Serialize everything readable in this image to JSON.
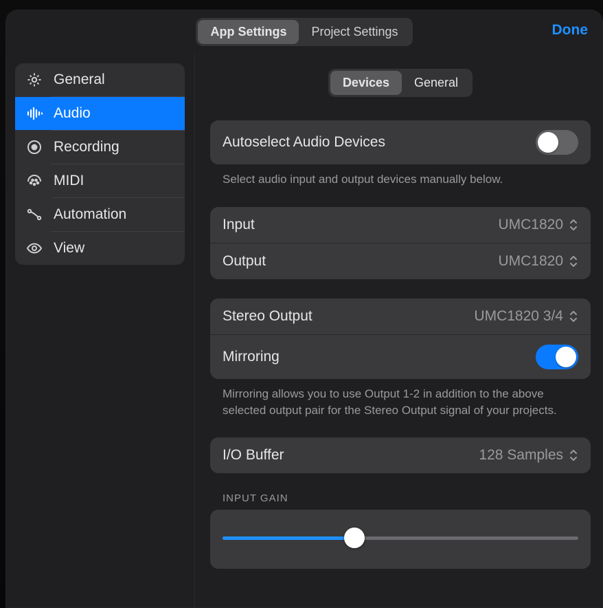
{
  "top": {
    "done": "Done",
    "seg": {
      "app": "App Settings",
      "project": "Project Settings"
    }
  },
  "sidebar": {
    "items": [
      {
        "label": "General"
      },
      {
        "label": "Audio"
      },
      {
        "label": "Recording"
      },
      {
        "label": "MIDI"
      },
      {
        "label": "Automation"
      },
      {
        "label": "View"
      }
    ]
  },
  "subseg": {
    "devices": "Devices",
    "general": "General"
  },
  "rows": {
    "autoselect": {
      "label": "Autoselect Audio Devices"
    },
    "autoselect_hint": "Select audio input and output devices manually below.",
    "input": {
      "label": "Input",
      "value": "UMC1820"
    },
    "output": {
      "label": "Output",
      "value": "UMC1820"
    },
    "stereo": {
      "label": "Stereo Output",
      "value": "UMC1820 3/4"
    },
    "mirroring": {
      "label": "Mirroring"
    },
    "mirroring_hint": "Mirroring allows you to use Output 1-2 in addition to the above selected output pair for the Stereo Output signal of your projects.",
    "iobuffer": {
      "label": "I/O Buffer",
      "value": "128 Samples"
    },
    "input_gain_label": "INPUT GAIN"
  }
}
